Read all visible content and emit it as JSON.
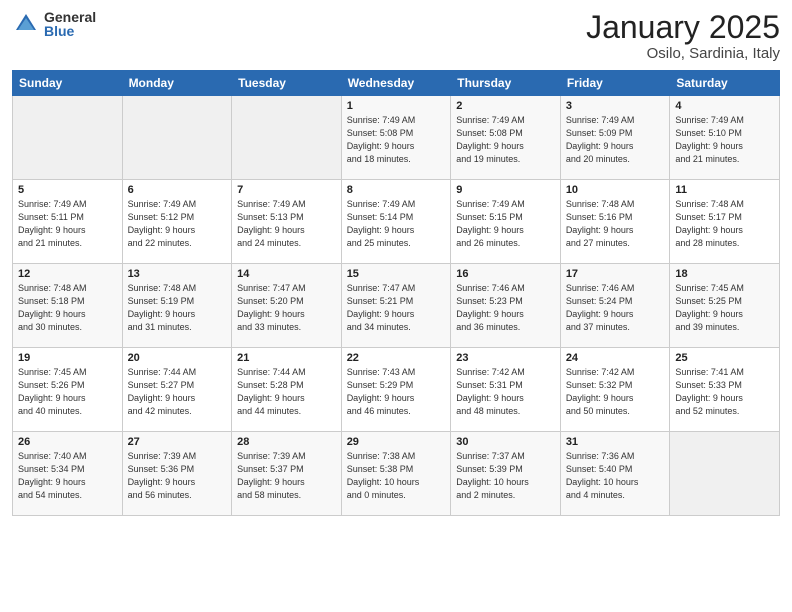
{
  "header": {
    "logo_general": "General",
    "logo_blue": "Blue",
    "month_title": "January 2025",
    "location": "Osilo, Sardinia, Italy"
  },
  "days_of_week": [
    "Sunday",
    "Monday",
    "Tuesday",
    "Wednesday",
    "Thursday",
    "Friday",
    "Saturday"
  ],
  "weeks": [
    [
      {
        "day": "",
        "info": ""
      },
      {
        "day": "",
        "info": ""
      },
      {
        "day": "",
        "info": ""
      },
      {
        "day": "1",
        "info": "Sunrise: 7:49 AM\nSunset: 5:08 PM\nDaylight: 9 hours\nand 18 minutes."
      },
      {
        "day": "2",
        "info": "Sunrise: 7:49 AM\nSunset: 5:08 PM\nDaylight: 9 hours\nand 19 minutes."
      },
      {
        "day": "3",
        "info": "Sunrise: 7:49 AM\nSunset: 5:09 PM\nDaylight: 9 hours\nand 20 minutes."
      },
      {
        "day": "4",
        "info": "Sunrise: 7:49 AM\nSunset: 5:10 PM\nDaylight: 9 hours\nand 21 minutes."
      }
    ],
    [
      {
        "day": "5",
        "info": "Sunrise: 7:49 AM\nSunset: 5:11 PM\nDaylight: 9 hours\nand 21 minutes."
      },
      {
        "day": "6",
        "info": "Sunrise: 7:49 AM\nSunset: 5:12 PM\nDaylight: 9 hours\nand 22 minutes."
      },
      {
        "day": "7",
        "info": "Sunrise: 7:49 AM\nSunset: 5:13 PM\nDaylight: 9 hours\nand 24 minutes."
      },
      {
        "day": "8",
        "info": "Sunrise: 7:49 AM\nSunset: 5:14 PM\nDaylight: 9 hours\nand 25 minutes."
      },
      {
        "day": "9",
        "info": "Sunrise: 7:49 AM\nSunset: 5:15 PM\nDaylight: 9 hours\nand 26 minutes."
      },
      {
        "day": "10",
        "info": "Sunrise: 7:48 AM\nSunset: 5:16 PM\nDaylight: 9 hours\nand 27 minutes."
      },
      {
        "day": "11",
        "info": "Sunrise: 7:48 AM\nSunset: 5:17 PM\nDaylight: 9 hours\nand 28 minutes."
      }
    ],
    [
      {
        "day": "12",
        "info": "Sunrise: 7:48 AM\nSunset: 5:18 PM\nDaylight: 9 hours\nand 30 minutes."
      },
      {
        "day": "13",
        "info": "Sunrise: 7:48 AM\nSunset: 5:19 PM\nDaylight: 9 hours\nand 31 minutes."
      },
      {
        "day": "14",
        "info": "Sunrise: 7:47 AM\nSunset: 5:20 PM\nDaylight: 9 hours\nand 33 minutes."
      },
      {
        "day": "15",
        "info": "Sunrise: 7:47 AM\nSunset: 5:21 PM\nDaylight: 9 hours\nand 34 minutes."
      },
      {
        "day": "16",
        "info": "Sunrise: 7:46 AM\nSunset: 5:23 PM\nDaylight: 9 hours\nand 36 minutes."
      },
      {
        "day": "17",
        "info": "Sunrise: 7:46 AM\nSunset: 5:24 PM\nDaylight: 9 hours\nand 37 minutes."
      },
      {
        "day": "18",
        "info": "Sunrise: 7:45 AM\nSunset: 5:25 PM\nDaylight: 9 hours\nand 39 minutes."
      }
    ],
    [
      {
        "day": "19",
        "info": "Sunrise: 7:45 AM\nSunset: 5:26 PM\nDaylight: 9 hours\nand 40 minutes."
      },
      {
        "day": "20",
        "info": "Sunrise: 7:44 AM\nSunset: 5:27 PM\nDaylight: 9 hours\nand 42 minutes."
      },
      {
        "day": "21",
        "info": "Sunrise: 7:44 AM\nSunset: 5:28 PM\nDaylight: 9 hours\nand 44 minutes."
      },
      {
        "day": "22",
        "info": "Sunrise: 7:43 AM\nSunset: 5:29 PM\nDaylight: 9 hours\nand 46 minutes."
      },
      {
        "day": "23",
        "info": "Sunrise: 7:42 AM\nSunset: 5:31 PM\nDaylight: 9 hours\nand 48 minutes."
      },
      {
        "day": "24",
        "info": "Sunrise: 7:42 AM\nSunset: 5:32 PM\nDaylight: 9 hours\nand 50 minutes."
      },
      {
        "day": "25",
        "info": "Sunrise: 7:41 AM\nSunset: 5:33 PM\nDaylight: 9 hours\nand 52 minutes."
      }
    ],
    [
      {
        "day": "26",
        "info": "Sunrise: 7:40 AM\nSunset: 5:34 PM\nDaylight: 9 hours\nand 54 minutes."
      },
      {
        "day": "27",
        "info": "Sunrise: 7:39 AM\nSunset: 5:36 PM\nDaylight: 9 hours\nand 56 minutes."
      },
      {
        "day": "28",
        "info": "Sunrise: 7:39 AM\nSunset: 5:37 PM\nDaylight: 9 hours\nand 58 minutes."
      },
      {
        "day": "29",
        "info": "Sunrise: 7:38 AM\nSunset: 5:38 PM\nDaylight: 10 hours\nand 0 minutes."
      },
      {
        "day": "30",
        "info": "Sunrise: 7:37 AM\nSunset: 5:39 PM\nDaylight: 10 hours\nand 2 minutes."
      },
      {
        "day": "31",
        "info": "Sunrise: 7:36 AM\nSunset: 5:40 PM\nDaylight: 10 hours\nand 4 minutes."
      },
      {
        "day": "",
        "info": ""
      }
    ]
  ]
}
